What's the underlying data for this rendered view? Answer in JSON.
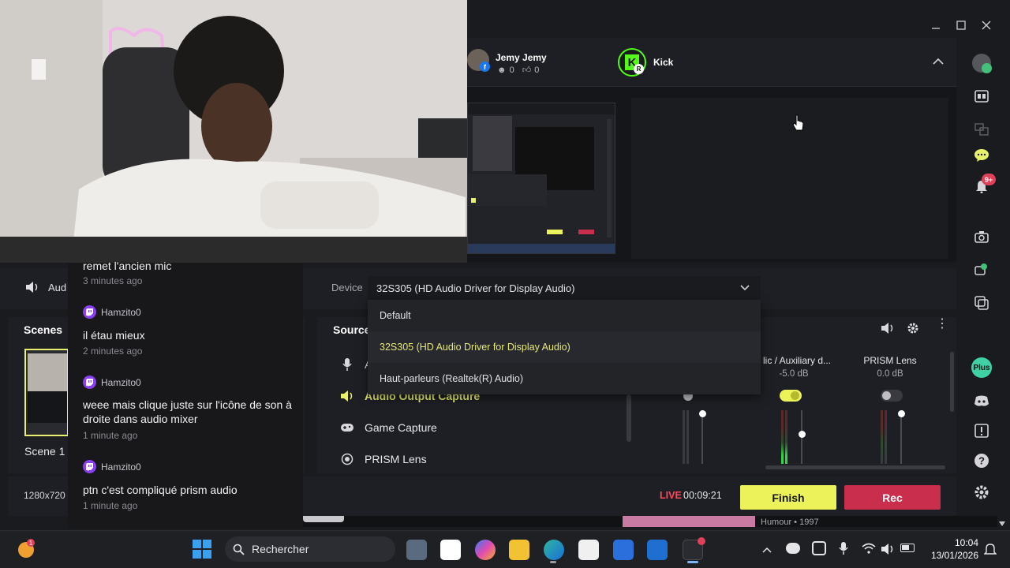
{
  "window": {
    "channels": [
      {
        "name": "Jemy Jemy",
        "viewers": "0",
        "likes": "0"
      },
      {
        "name": "Kick"
      }
    ]
  },
  "audio_device": {
    "section_label": "Aud",
    "device_label": "Device",
    "selected": "32S305 (HD Audio Driver for Display Audio)",
    "options": [
      "Default",
      "32S305 (HD Audio Driver for Display Audio)",
      "Haut-parleurs (Realtek(R) Audio)"
    ]
  },
  "scenes": {
    "title": "Scenes",
    "items": [
      {
        "label": "Scene 1"
      }
    ]
  },
  "sources": {
    "title": "Source",
    "items": [
      {
        "label": "A",
        "icon": "microphone-icon"
      },
      {
        "label": "Audio Output Capture",
        "icon": "speaker-icon",
        "active": true
      },
      {
        "label": "Game Capture",
        "icon": "gamepad-icon"
      },
      {
        "label": "PRISM Lens",
        "icon": "lens-icon"
      }
    ]
  },
  "mixer": {
    "channels": [
      {
        "name": "",
        "db": ""
      },
      {
        "name": "lic / Auxiliary d...",
        "db": "-5.0 dB"
      },
      {
        "name": "PRISM Lens",
        "db": "0.0 dB"
      }
    ]
  },
  "bottom": {
    "resolution": "1280x720",
    "live_label": "LIVE",
    "timer": "00:09:21",
    "finish": "Finish",
    "rec": "Rec",
    "media_caption": "Humour • 1997"
  },
  "sidebar": {
    "plus_label": "Plus",
    "notif_badge": "9+"
  },
  "chat": {
    "messages": [
      {
        "user": "",
        "text": "remet l'ancien mic",
        "time": "3 minutes ago"
      },
      {
        "user": "Hamzito0",
        "text": "il étau mieux",
        "time": "2 minutes ago"
      },
      {
        "user": "Hamzito0",
        "text": "weee mais clique juste sur l'icône de son à droite dans audio mixer",
        "time": "1 minute ago"
      },
      {
        "user": "Hamzito0",
        "text": "ptn c'est compliqué prism audio",
        "time": "1 minute ago"
      }
    ]
  },
  "taskbar": {
    "search_label": "Rechercher",
    "time": "10:04",
    "date": "13/01/2026"
  },
  "colors": {
    "accent_yellow": "#ecf35a",
    "rec_red": "#c92f4c",
    "live_red": "#ff4a5c",
    "twitch_purple": "#8a3ff5",
    "kick_green": "#53fc18"
  }
}
